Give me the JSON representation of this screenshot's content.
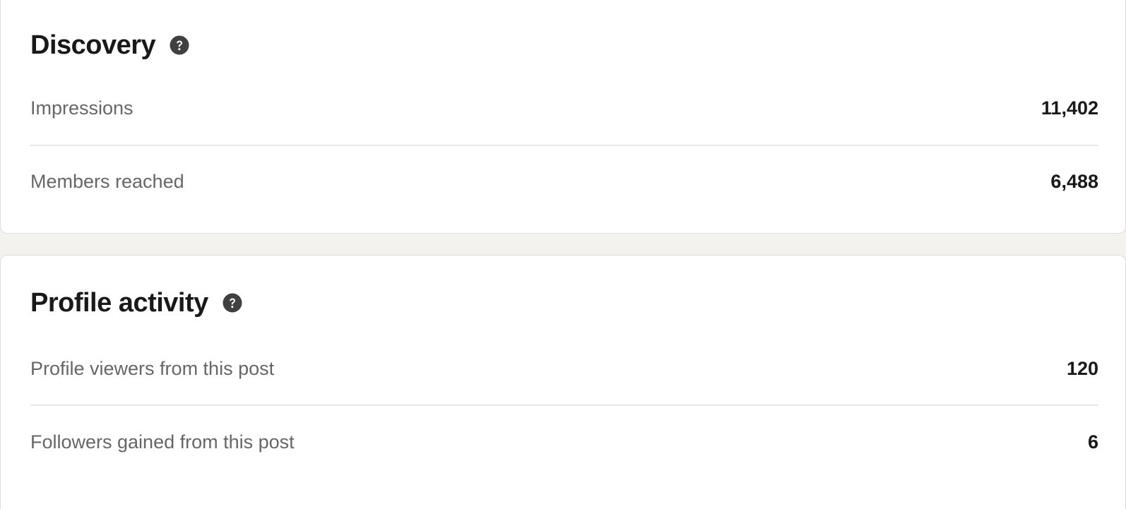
{
  "discovery": {
    "title": "Discovery",
    "help_icon": "question-circle-icon",
    "rows": [
      {
        "label": "Impressions",
        "value": "11,402"
      },
      {
        "label": "Members reached",
        "value": "6,488"
      }
    ]
  },
  "profile_activity": {
    "title": "Profile activity",
    "help_icon": "question-circle-icon",
    "rows": [
      {
        "label": "Profile viewers from this post",
        "value": "120"
      },
      {
        "label": "Followers gained from this post",
        "value": "6"
      }
    ]
  },
  "colors": {
    "page_background": "#f3f2ef",
    "card_background": "#ffffff",
    "heading_text": "#191919",
    "label_text": "#666666",
    "icon": "#404040",
    "divider": "#e8e8e8"
  }
}
